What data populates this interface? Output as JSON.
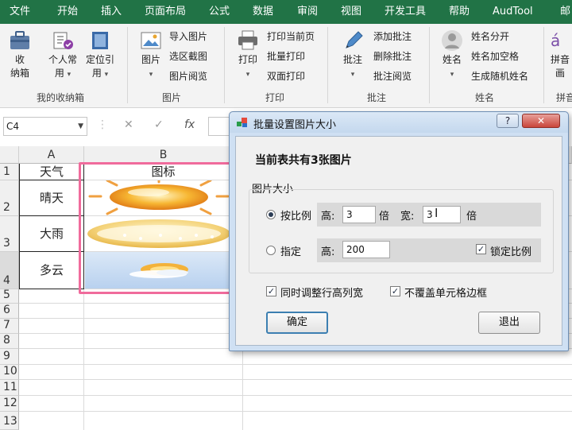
{
  "ribbon_tabs": [
    "文件",
    "开始",
    "插入",
    "页面布局",
    "公式",
    "数据",
    "审阅",
    "视图",
    "开发工具",
    "帮助",
    "AudTool",
    "邮"
  ],
  "ribbon": {
    "groups": {
      "storage": {
        "label": "我的收纳箱",
        "btn_storage": "收\n纳箱",
        "btn_personal": "个人常\n用",
        "btn_locate": "定位引\n用"
      },
      "picture": {
        "label": "图片",
        "btn_picture": "图片",
        "import": "导入图片",
        "region": "选区截图",
        "browse": "图片阅览"
      },
      "print": {
        "label": "打印",
        "btn_print": "打印",
        "current": "打印当前页",
        "batch": "批量打印",
        "duplex": "双面打印"
      },
      "comment": {
        "label": "批注",
        "btn_comment": "批注",
        "add": "添加批注",
        "delete": "删除批注",
        "browse": "批注阅览"
      },
      "name": {
        "label": "姓名",
        "btn_name": "姓名",
        "split": "姓名分开",
        "space": "姓名加空格",
        "random": "生成随机姓名"
      },
      "pinyin": {
        "label": "拼音",
        "btn_pinyin": "拼音\n画"
      }
    }
  },
  "formula_bar": {
    "name_box": "C4",
    "cancel_icon": "✕",
    "confirm_icon": "✓",
    "fx_label": "fx",
    "formula": ""
  },
  "columns": [
    "A",
    "B"
  ],
  "rows": [
    "1",
    "2",
    "3",
    "4",
    "5",
    "6",
    "7",
    "8",
    "9",
    "10",
    "11",
    "12",
    "13"
  ],
  "cells": {
    "A1": "天气",
    "B1": "图标",
    "A2": "晴天",
    "A3": "大雨",
    "A4": "多云"
  },
  "dialog": {
    "title": "批量设置图片大小",
    "help_btn": "?",
    "close_btn": "✕",
    "heading": "当前表共有3张图片",
    "group_label": "图片大小",
    "ratio_option": "按比例",
    "height_label": "高:",
    "height_value": "3",
    "times_1": "倍",
    "width_label": "宽:",
    "width_value": "3",
    "times_2": "倍",
    "specify_option": "指定",
    "height_label_2": "高:",
    "height_value_2": "200",
    "lock_ratio": "锁定比例",
    "adjust_rows_cols": "同时调整行高列宽",
    "no_cover_border": "不覆盖单元格边框",
    "ok": "确定",
    "exit": "退出",
    "ratio_selected": true,
    "lock_ratio_checked": true,
    "adjust_checked": true,
    "no_cover_checked": true
  },
  "colors": {
    "ribbon_green": "#217346",
    "highlight_pink": "#f06b9c",
    "dialog_frame": "#cfe0f3"
  }
}
